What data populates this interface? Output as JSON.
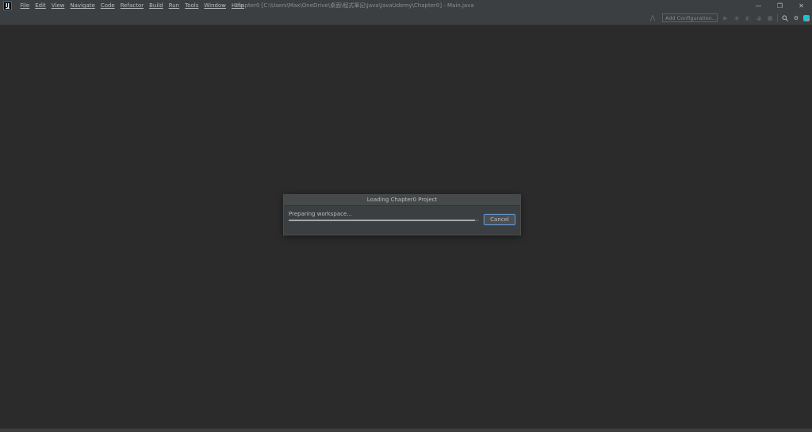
{
  "app": {
    "logo_text": "IJ"
  },
  "menu": [
    "File",
    "Edit",
    "View",
    "Navigate",
    "Code",
    "Refactor",
    "Build",
    "Run",
    "Tools",
    "Window",
    "Help"
  ],
  "window": {
    "title": "Chapter0 [C:\\Users\\Max\\OneDrive\\桌面\\程式筆記\\Java\\JavaUdemy\\Chapter0] - Main.java",
    "minimize_icon": "minimize-icon",
    "restore_icon": "restore-icon",
    "close_icon": "close-icon"
  },
  "toolbar": {
    "add_configuration_label": "Add Configuration...",
    "icons": [
      "build-hammer-icon",
      "run-icon",
      "debug-icon",
      "coverage-icon",
      "profile-icon",
      "stop-icon",
      "search-icon",
      "settings-icon",
      "jetbrains-toolbox-icon"
    ]
  },
  "dialog": {
    "title": "Loading Chapter0 Project",
    "status_text": "Preparing workspace...",
    "progress": 0.98,
    "cancel_label": "Cancel"
  },
  "colors": {
    "background": "#2b2b2b",
    "panel": "#3c3f41",
    "accent_focus": "#5f93cf"
  }
}
